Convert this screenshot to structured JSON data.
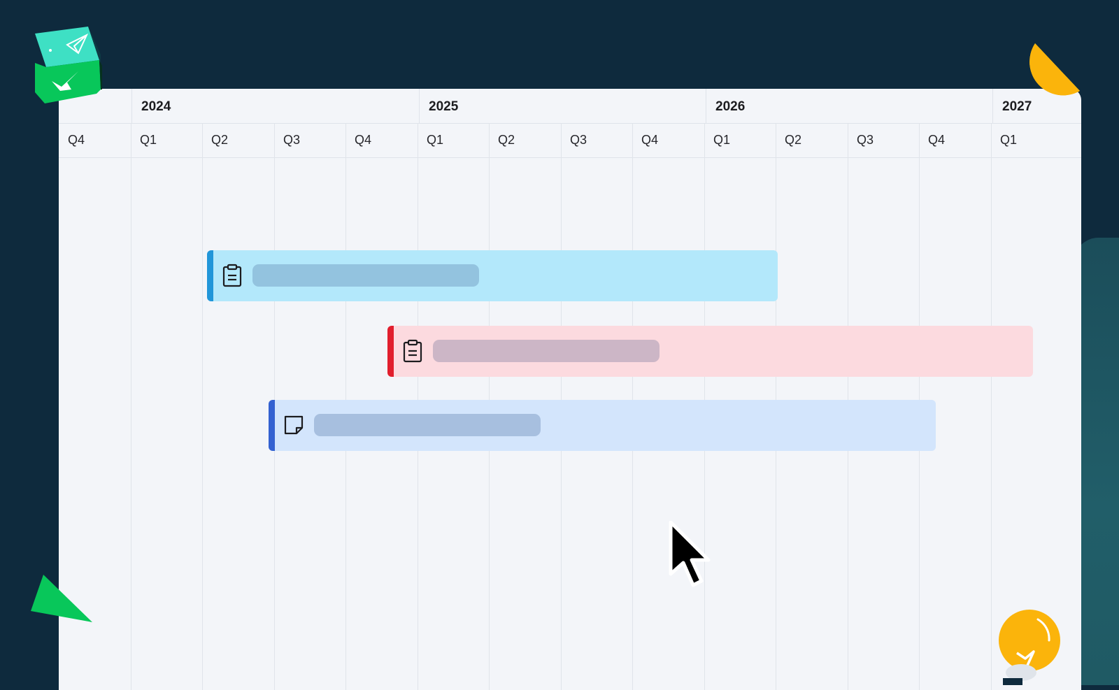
{
  "timeline": {
    "years": [
      {
        "label": "2024"
      },
      {
        "label": "2025"
      },
      {
        "label": "2026"
      },
      {
        "label": "2027"
      }
    ],
    "quarters": [
      "Q4",
      "Q1",
      "Q2",
      "Q3",
      "Q4",
      "Q1",
      "Q2",
      "Q3",
      "Q4",
      "Q1",
      "Q2",
      "Q3",
      "Q4",
      "Q1"
    ]
  },
  "tasks": [
    {
      "icon": "clipboard-icon",
      "start": "2024 Q2",
      "end": "2025 Q4",
      "fill": "#b3e8fb",
      "accent": "#2196d9",
      "title_placeholder": "#93c3df"
    },
    {
      "icon": "clipboard-icon",
      "start": "2024 Q4 (mid)",
      "end": "2027 Q1 (mid)",
      "fill": "#fcdadf",
      "accent": "#e11e2d",
      "title_placeholder": "#ccb6c6"
    },
    {
      "icon": "sticky-note-icon",
      "start": "2024 Q3 (late)",
      "end": "2026 Q3",
      "fill": "#d3e5fc",
      "accent": "#3361d1",
      "title_placeholder": "#a7bfdf"
    }
  ],
  "colors": {
    "background": "#0e2a3d",
    "board": "#f3f5f9",
    "deco_green": "#08c75a",
    "deco_yellow": "#fbb40b"
  },
  "decorations": [
    "paper-plane-cube-icon",
    "yellow-quarter-circle",
    "green-triangle",
    "lightbulb-icon"
  ]
}
